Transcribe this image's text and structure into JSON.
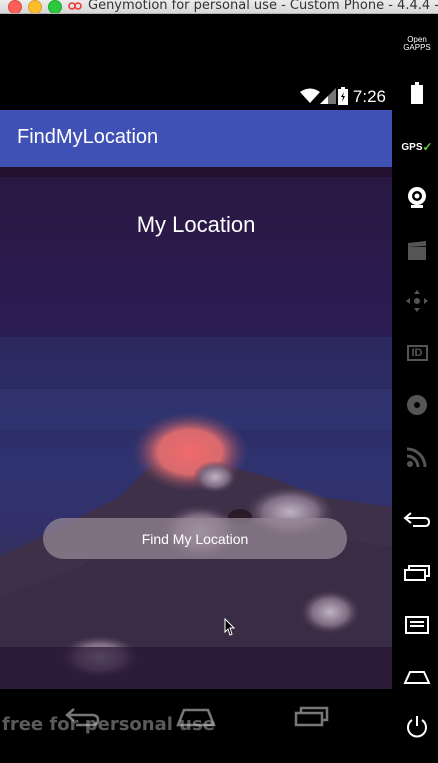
{
  "window": {
    "title": "Genymotion for personal use - Custom Phone - 4.4.4 - A..."
  },
  "emulator_toolbar": {
    "open_gapps_label": "Open\nGAPPS",
    "gps_label": "GPS",
    "id_label": "ID"
  },
  "status_bar": {
    "time": "7:26"
  },
  "app_bar": {
    "title": "FindMyLocation"
  },
  "main": {
    "heading": "My Location",
    "find_button_label": "Find My Location"
  },
  "watermark": {
    "text": "free for personal use"
  },
  "colors": {
    "app_bar": "#3f51b5",
    "close": "#fc5f57",
    "minimize": "#fdbc2e",
    "maximize": "#2bc840"
  }
}
